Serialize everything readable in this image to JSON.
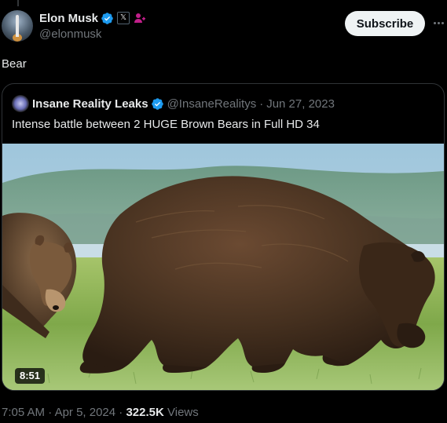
{
  "author": {
    "name": "Elon Musk",
    "handle": "@elonmusk",
    "verified_icon": "verified-badge-icon",
    "x_badge": "𝕏",
    "affiliate_icon": "person-badge-icon"
  },
  "actions": {
    "subscribe_label": "Subscribe",
    "more_icon": "more-dots-icon"
  },
  "tweet": {
    "text": "Bear"
  },
  "quoted": {
    "name": "Insane Reality Leaks",
    "handle": "@InsaneRealitys",
    "separator": "·",
    "date": "Jun 27, 2023",
    "text": "Intense battle between 2 HUGE Brown Bears in Full HD 34",
    "video_duration": "8:51"
  },
  "meta": {
    "time": "7:05 AM",
    "date": "Apr 5, 2024",
    "separator": "·",
    "views_count": "322.5K",
    "views_label": "Views"
  },
  "colors": {
    "background": "#000000",
    "text": "#e7e9ea",
    "muted": "#71767b",
    "verified_blue": "#1d9bf0",
    "affiliate_pink": "#c21f8a"
  }
}
